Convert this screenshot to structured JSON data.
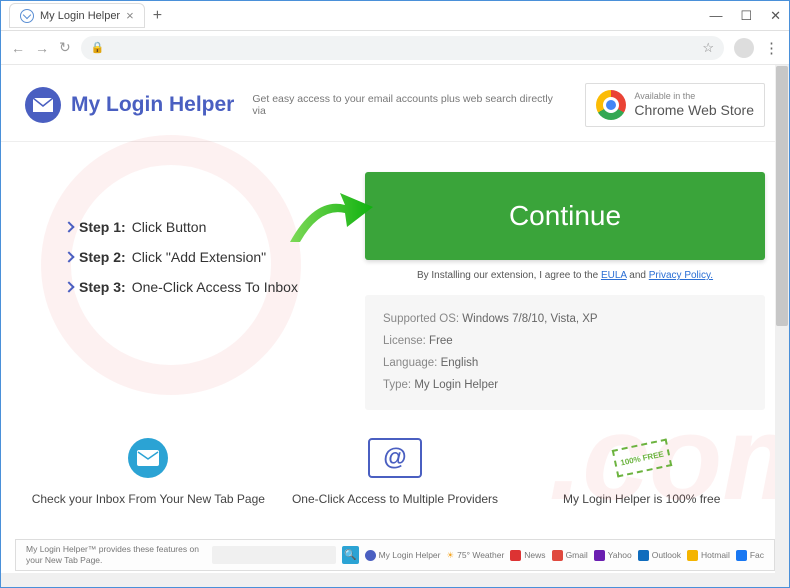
{
  "window": {
    "tab_title": "My Login Helper",
    "minimize": "—",
    "maximize": "☐",
    "close": "✕",
    "new_tab": "+"
  },
  "header": {
    "brand": "My Login Helper",
    "tagline": "Get easy access to your email accounts plus web search directly via",
    "cws_available": "Available in the",
    "cws_name": "Chrome Web Store"
  },
  "steps": [
    {
      "label": "Step 1:",
      "text": "Click Button"
    },
    {
      "label": "Step 2:",
      "text": "Click \"Add Extension\""
    },
    {
      "label": "Step 3:",
      "text": "One-Click Access To Inbox"
    }
  ],
  "cta": {
    "button": "Continue",
    "agree_prefix": "By Installing our extension, I agree to the ",
    "eula": "EULA",
    "and": " and ",
    "privacy": "Privacy Policy."
  },
  "info": {
    "os_label": "Supported OS:",
    "os_value": "Windows 7/8/10, Vista, XP",
    "license_label": "License:",
    "license_value": "Free",
    "language_label": "Language:",
    "language_value": "English",
    "type_label": "Type:",
    "type_value": "My Login Helper"
  },
  "features": [
    {
      "text": "Check your Inbox From Your New Tab Page"
    },
    {
      "text": "One-Click Access to Multiple Providers"
    },
    {
      "text": "My Login Helper is 100% free"
    }
  ],
  "free_stamp": "100% FREE",
  "footer": {
    "note": "My Login Helper™ provides these features on your New Tab Page.",
    "brand": "My Login Helper",
    "weather": "75° Weather",
    "links": [
      "News",
      "Gmail",
      "Yahoo",
      "Outlook",
      "Hotmail",
      "Fac"
    ]
  }
}
